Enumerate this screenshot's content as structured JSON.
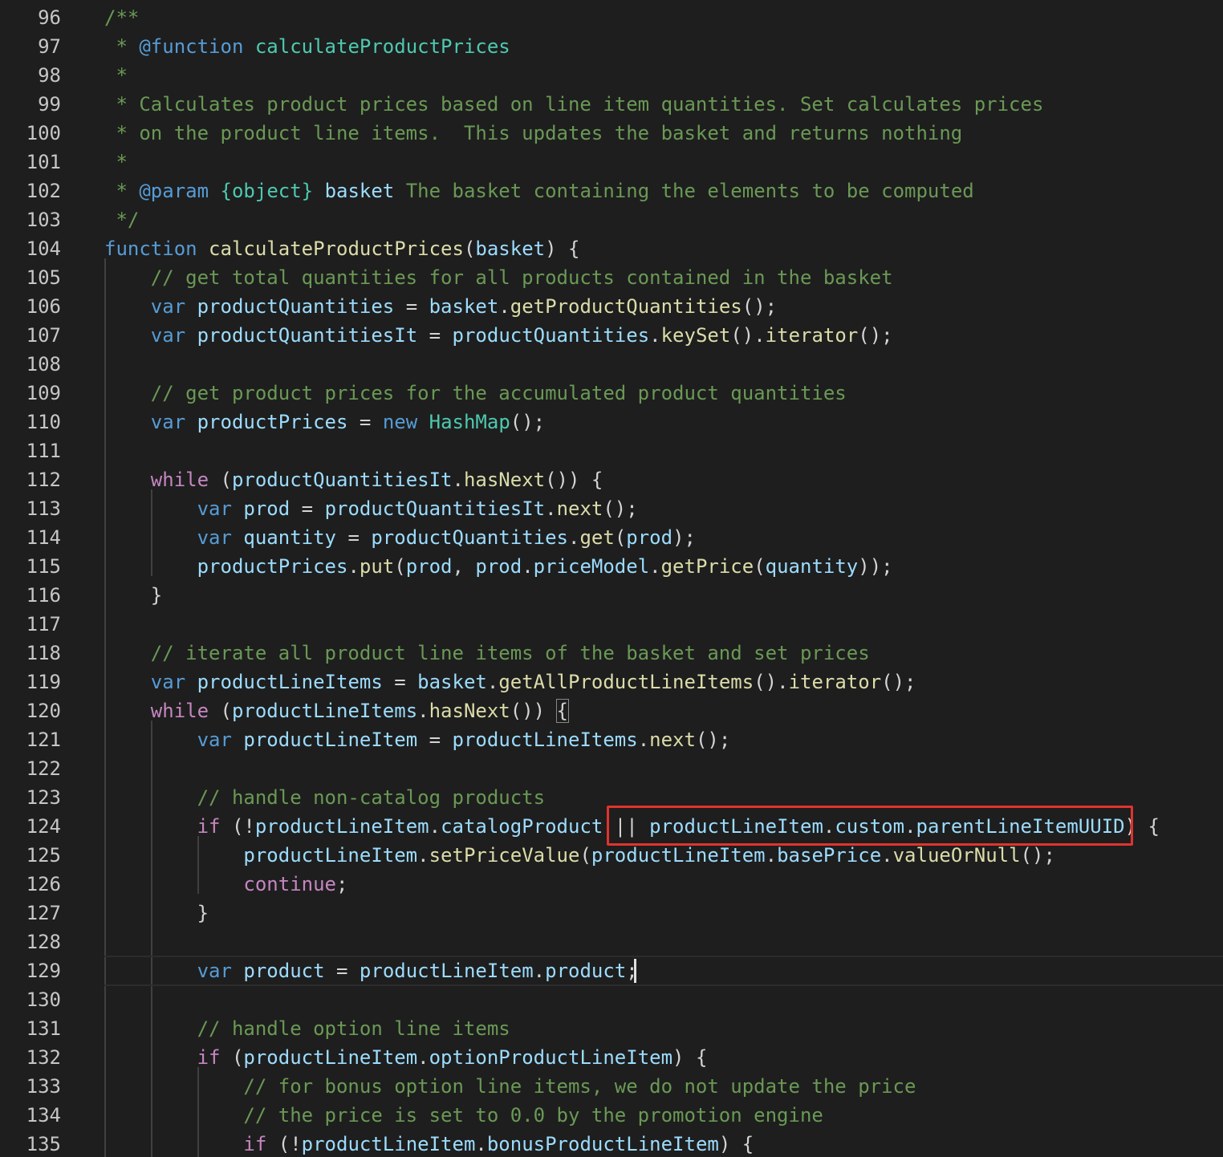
{
  "editor": {
    "first_line": 96,
    "annotation": "highlight around '|| productLineItem.custom.parentLineItemUUID)'",
    "current_line": 129,
    "lines": [
      {
        "n": "96",
        "indent": 0,
        "tokens": [
          [
            "/**",
            "comment"
          ]
        ]
      },
      {
        "n": "97",
        "indent": 0,
        "tokens": [
          [
            " * ",
            "comment"
          ],
          [
            "@function",
            "keyword"
          ],
          [
            " ",
            "comment"
          ],
          [
            "calculateProductPrices",
            "type"
          ]
        ]
      },
      {
        "n": "98",
        "indent": 0,
        "tokens": [
          [
            " *",
            "comment"
          ]
        ]
      },
      {
        "n": "99",
        "indent": 0,
        "tokens": [
          [
            " * Calculates product prices based on line item quantities. Set calculates prices",
            "comment"
          ]
        ]
      },
      {
        "n": "100",
        "indent": 0,
        "tokens": [
          [
            " * on the product line items.  This updates the basket and returns nothing",
            "comment"
          ]
        ]
      },
      {
        "n": "101",
        "indent": 0,
        "tokens": [
          [
            " *",
            "comment"
          ]
        ]
      },
      {
        "n": "102",
        "indent": 0,
        "tokens": [
          [
            " * ",
            "comment"
          ],
          [
            "@param",
            "keyword"
          ],
          [
            " ",
            "comment"
          ],
          [
            "{object}",
            "type"
          ],
          [
            " ",
            "comment"
          ],
          [
            "basket",
            "var"
          ],
          [
            " The basket containing the elements to be computed",
            "comment"
          ]
        ]
      },
      {
        "n": "103",
        "indent": 0,
        "tokens": [
          [
            " */",
            "comment"
          ]
        ]
      },
      {
        "n": "104",
        "indent": 0,
        "tokens": [
          [
            "function",
            "keyword"
          ],
          [
            " ",
            "plain"
          ],
          [
            "calculateProductPrices",
            "func"
          ],
          [
            "(",
            "plain"
          ],
          [
            "basket",
            "var"
          ],
          [
            ") {",
            "plain"
          ]
        ]
      },
      {
        "n": "105",
        "indent": 4,
        "tokens": [
          [
            "// get total quantities for all products contained in the basket",
            "comment"
          ]
        ]
      },
      {
        "n": "106",
        "indent": 4,
        "tokens": [
          [
            "var",
            "keyword"
          ],
          [
            " ",
            "plain"
          ],
          [
            "productQuantities",
            "var"
          ],
          [
            " = ",
            "plain"
          ],
          [
            "basket",
            "var"
          ],
          [
            ".",
            "plain"
          ],
          [
            "getProductQuantities",
            "func"
          ],
          [
            "();",
            "plain"
          ]
        ]
      },
      {
        "n": "107",
        "indent": 4,
        "tokens": [
          [
            "var",
            "keyword"
          ],
          [
            " ",
            "plain"
          ],
          [
            "productQuantitiesIt",
            "var"
          ],
          [
            " = ",
            "plain"
          ],
          [
            "productQuantities",
            "var"
          ],
          [
            ".",
            "plain"
          ],
          [
            "keySet",
            "func"
          ],
          [
            "().",
            "plain"
          ],
          [
            "iterator",
            "func"
          ],
          [
            "();",
            "plain"
          ]
        ]
      },
      {
        "n": "108",
        "indent": 0,
        "tokens": []
      },
      {
        "n": "109",
        "indent": 4,
        "tokens": [
          [
            "// get product prices for the accumulated product quantities",
            "comment"
          ]
        ]
      },
      {
        "n": "110",
        "indent": 4,
        "tokens": [
          [
            "var",
            "keyword"
          ],
          [
            " ",
            "plain"
          ],
          [
            "productPrices",
            "var"
          ],
          [
            " = ",
            "plain"
          ],
          [
            "new",
            "keyword"
          ],
          [
            " ",
            "plain"
          ],
          [
            "HashMap",
            "type"
          ],
          [
            "();",
            "plain"
          ]
        ]
      },
      {
        "n": "111",
        "indent": 0,
        "tokens": []
      },
      {
        "n": "112",
        "indent": 4,
        "tokens": [
          [
            "while",
            "control"
          ],
          [
            " (",
            "plain"
          ],
          [
            "productQuantitiesIt",
            "var"
          ],
          [
            ".",
            "plain"
          ],
          [
            "hasNext",
            "func"
          ],
          [
            "()) {",
            "plain"
          ]
        ]
      },
      {
        "n": "113",
        "indent": 8,
        "tokens": [
          [
            "var",
            "keyword"
          ],
          [
            " ",
            "plain"
          ],
          [
            "prod",
            "var"
          ],
          [
            " = ",
            "plain"
          ],
          [
            "productQuantitiesIt",
            "var"
          ],
          [
            ".",
            "plain"
          ],
          [
            "next",
            "func"
          ],
          [
            "();",
            "plain"
          ]
        ]
      },
      {
        "n": "114",
        "indent": 8,
        "tokens": [
          [
            "var",
            "keyword"
          ],
          [
            " ",
            "plain"
          ],
          [
            "quantity",
            "var"
          ],
          [
            " = ",
            "plain"
          ],
          [
            "productQuantities",
            "var"
          ],
          [
            ".",
            "plain"
          ],
          [
            "get",
            "func"
          ],
          [
            "(",
            "plain"
          ],
          [
            "prod",
            "var"
          ],
          [
            ");",
            "plain"
          ]
        ]
      },
      {
        "n": "115",
        "indent": 8,
        "tokens": [
          [
            "productPrices",
            "var"
          ],
          [
            ".",
            "plain"
          ],
          [
            "put",
            "func"
          ],
          [
            "(",
            "plain"
          ],
          [
            "prod",
            "var"
          ],
          [
            ", ",
            "plain"
          ],
          [
            "prod",
            "var"
          ],
          [
            ".",
            "plain"
          ],
          [
            "priceModel",
            "var"
          ],
          [
            ".",
            "plain"
          ],
          [
            "getPrice",
            "func"
          ],
          [
            "(",
            "plain"
          ],
          [
            "quantity",
            "var"
          ],
          [
            "));",
            "plain"
          ]
        ]
      },
      {
        "n": "116",
        "indent": 4,
        "tokens": [
          [
            "}",
            "plain"
          ]
        ]
      },
      {
        "n": "117",
        "indent": 0,
        "tokens": []
      },
      {
        "n": "118",
        "indent": 4,
        "tokens": [
          [
            "// iterate all product line items of the basket and set prices",
            "comment"
          ]
        ]
      },
      {
        "n": "119",
        "indent": 4,
        "tokens": [
          [
            "var",
            "keyword"
          ],
          [
            " ",
            "plain"
          ],
          [
            "productLineItems",
            "var"
          ],
          [
            " = ",
            "plain"
          ],
          [
            "basket",
            "var"
          ],
          [
            ".",
            "plain"
          ],
          [
            "getAllProductLineItems",
            "func"
          ],
          [
            "().",
            "plain"
          ],
          [
            "iterator",
            "func"
          ],
          [
            "();",
            "plain"
          ]
        ]
      },
      {
        "n": "120",
        "indent": 4,
        "tokens": [
          [
            "while",
            "control"
          ],
          [
            " (",
            "plain"
          ],
          [
            "productLineItems",
            "var"
          ],
          [
            ".",
            "plain"
          ],
          [
            "hasNext",
            "func"
          ],
          [
            "()) ",
            "plain"
          ],
          [
            "{",
            "bracket-match"
          ]
        ]
      },
      {
        "n": "121",
        "indent": 8,
        "tokens": [
          [
            "var",
            "keyword"
          ],
          [
            " ",
            "plain"
          ],
          [
            "productLineItem",
            "var"
          ],
          [
            " = ",
            "plain"
          ],
          [
            "productLineItems",
            "var"
          ],
          [
            ".",
            "plain"
          ],
          [
            "next",
            "func"
          ],
          [
            "();",
            "plain"
          ]
        ]
      },
      {
        "n": "122",
        "indent": 0,
        "tokens": []
      },
      {
        "n": "123",
        "indent": 8,
        "tokens": [
          [
            "// handle non-catalog products",
            "comment"
          ]
        ]
      },
      {
        "n": "124",
        "indent": 8,
        "tokens": [
          [
            "if",
            "control"
          ],
          [
            " (!",
            "plain"
          ],
          [
            "productLineItem",
            "var"
          ],
          [
            ".",
            "plain"
          ],
          [
            "catalogProduct",
            "var"
          ],
          [
            " || ",
            "plain"
          ],
          [
            "productLineItem",
            "var"
          ],
          [
            ".",
            "plain"
          ],
          [
            "custom",
            "var"
          ],
          [
            ".",
            "plain"
          ],
          [
            "parentLineItemUUID",
            "var"
          ],
          [
            ") {",
            "plain"
          ]
        ]
      },
      {
        "n": "125",
        "indent": 12,
        "tokens": [
          [
            "productLineItem",
            "var"
          ],
          [
            ".",
            "plain"
          ],
          [
            "setPriceValue",
            "func"
          ],
          [
            "(",
            "plain"
          ],
          [
            "productLineItem",
            "var"
          ],
          [
            ".",
            "plain"
          ],
          [
            "basePrice",
            "var"
          ],
          [
            ".",
            "plain"
          ],
          [
            "valueOrNull",
            "func"
          ],
          [
            "();",
            "plain"
          ]
        ]
      },
      {
        "n": "126",
        "indent": 12,
        "tokens": [
          [
            "continue",
            "control"
          ],
          [
            ";",
            "plain"
          ]
        ]
      },
      {
        "n": "127",
        "indent": 8,
        "tokens": [
          [
            "}",
            "plain"
          ]
        ]
      },
      {
        "n": "128",
        "indent": 0,
        "tokens": []
      },
      {
        "n": "129",
        "indent": 8,
        "tokens": [
          [
            "var",
            "keyword"
          ],
          [
            " ",
            "plain"
          ],
          [
            "product",
            "var"
          ],
          [
            " = ",
            "plain"
          ],
          [
            "productLineItem",
            "var"
          ],
          [
            ".",
            "plain"
          ],
          [
            "product",
            "var"
          ],
          [
            ";",
            "plain"
          ]
        ]
      },
      {
        "n": "130",
        "indent": 0,
        "tokens": []
      },
      {
        "n": "131",
        "indent": 8,
        "tokens": [
          [
            "// handle option line items",
            "comment"
          ]
        ]
      },
      {
        "n": "132",
        "indent": 8,
        "tokens": [
          [
            "if",
            "control"
          ],
          [
            " (",
            "plain"
          ],
          [
            "productLineItem",
            "var"
          ],
          [
            ".",
            "plain"
          ],
          [
            "optionProductLineItem",
            "var"
          ],
          [
            ") {",
            "plain"
          ]
        ]
      },
      {
        "n": "133",
        "indent": 12,
        "tokens": [
          [
            "// for bonus option line items, we do not update the price",
            "comment"
          ]
        ]
      },
      {
        "n": "134",
        "indent": 12,
        "tokens": [
          [
            "// the price is set to 0.0 by the promotion engine",
            "comment"
          ]
        ]
      },
      {
        "n": "135",
        "indent": 12,
        "tokens": [
          [
            "if",
            "control"
          ],
          [
            " (!",
            "plain"
          ],
          [
            "productLineItem",
            "var"
          ],
          [
            ".",
            "plain"
          ],
          [
            "bonusProductLineItem",
            "var"
          ],
          [
            ") {",
            "plain"
          ]
        ]
      }
    ]
  }
}
